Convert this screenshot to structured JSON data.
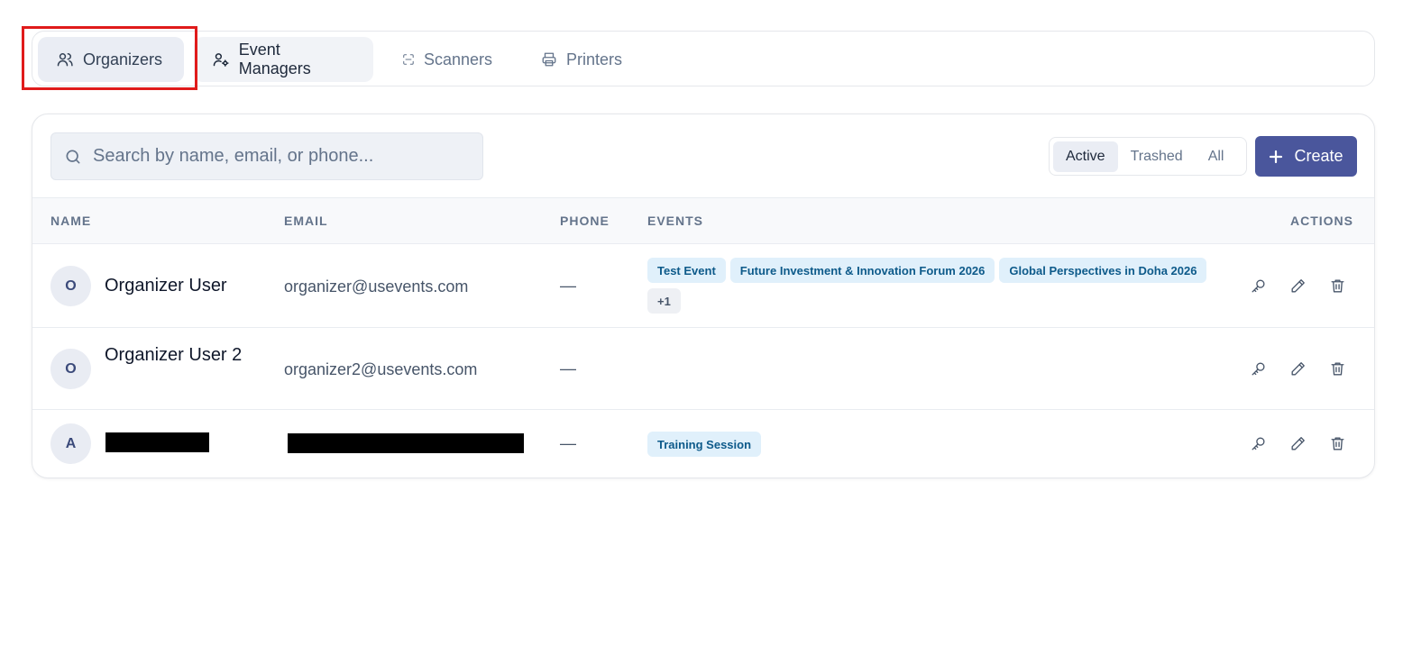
{
  "tabs": [
    {
      "label": "Organizers",
      "icon": "users-icon"
    },
    {
      "label": "Event Managers",
      "icon": "user-gear-icon"
    },
    {
      "label": "Scanners",
      "icon": "scan-icon"
    },
    {
      "label": "Printers",
      "icon": "printer-icon"
    }
  ],
  "toolbar": {
    "search_placeholder": "Search by name, email, or phone...",
    "filters": [
      "Active",
      "Trashed",
      "All"
    ],
    "active_filter": "Active",
    "create_label": "Create"
  },
  "table": {
    "headers": {
      "name": "NAME",
      "email": "EMAIL",
      "phone": "PHONE",
      "events": "EVENTS",
      "actions": "ACTIONS"
    },
    "rows": [
      {
        "initial": "O",
        "name": "Organizer User",
        "email": "organizer@usevents.com",
        "phone": "—",
        "events": [
          "Test Event",
          "Future Investment & Innovation Forum 2026",
          "Global Perspectives in Doha 2026"
        ],
        "more": "+1"
      },
      {
        "initial": "O",
        "name": "Organizer User 2",
        "email": "organizer2@usevents.com",
        "phone": "—",
        "events": []
      },
      {
        "initial": "A",
        "name": "",
        "email": "",
        "phone": "—",
        "events": [
          "Training Session"
        ],
        "redacted": true
      }
    ]
  },
  "colors": {
    "primary": "#4a569c",
    "highlight": "#e01b1b",
    "badge_bg": "#e0f0fb",
    "badge_text": "#0d5a8a"
  }
}
